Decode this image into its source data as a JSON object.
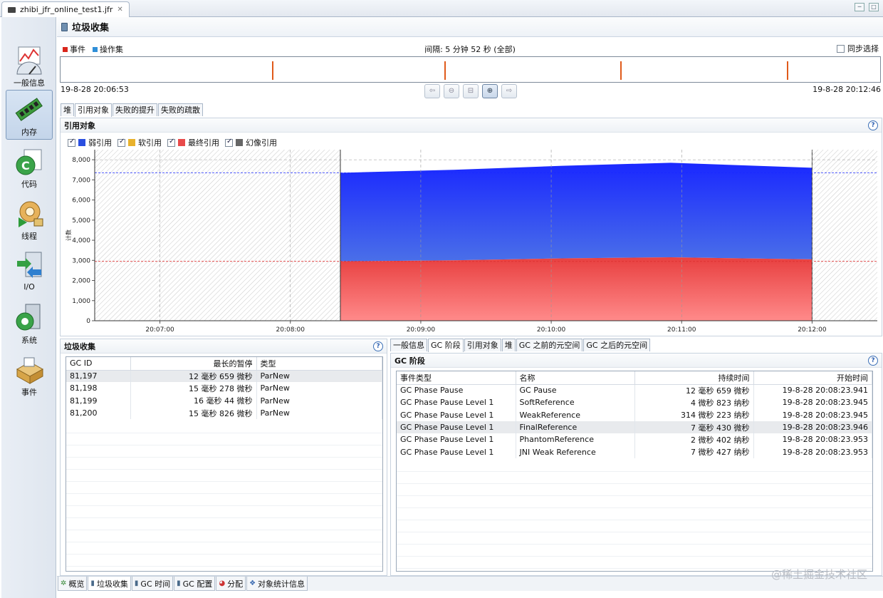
{
  "editor": {
    "file_tab": "zhibi_jfr_online_test1.jfr",
    "close": "✕"
  },
  "window_buttons": [
    "─",
    "□"
  ],
  "nav": [
    {
      "label": "一般信息",
      "icon": "general-info-icon"
    },
    {
      "label": "内存",
      "icon": "memory-icon",
      "active": true
    },
    {
      "label": "代码",
      "icon": "code-icon"
    },
    {
      "label": "线程",
      "icon": "threads-icon"
    },
    {
      "label": "I/O",
      "icon": "io-icon"
    },
    {
      "label": "系统",
      "icon": "system-icon"
    },
    {
      "label": "事件",
      "icon": "events-icon"
    }
  ],
  "header": {
    "title": "垃圾收集"
  },
  "overview": {
    "legend": [
      {
        "label": "事件",
        "color": "#d9261c"
      },
      {
        "label": "操作集",
        "color": "#2f8fd8"
      }
    ],
    "interval": "间隔: 5 分钟 52 秒 (全部)",
    "sync_label": "同步选择",
    "range_start": "19-8-28 20:06:53",
    "range_end": "19-8-28 20:12:46",
    "event_marks": [
      0.258,
      0.468,
      0.683,
      0.886
    ]
  },
  "zoom_buttons": [
    "⇦",
    "⊖",
    "⊟",
    "⊕",
    "⇨"
  ],
  "upper_tabs": [
    "堆",
    "引用对象",
    "失败的提升",
    "失败的疏散"
  ],
  "chart_section": {
    "title": "引用对象",
    "help": "?",
    "legend": [
      {
        "label": "弱引用",
        "color": "#2b4fe0"
      },
      {
        "label": "软引用",
        "color": "#e8b12c"
      },
      {
        "label": "最终引用",
        "color": "#e84a4a"
      },
      {
        "label": "幻像引用",
        "color": "#666666"
      }
    ]
  },
  "chart_data": {
    "type": "area",
    "ylabel": "计数",
    "ylim": [
      0,
      8500
    ],
    "yticks": [
      0,
      1000,
      2000,
      3000,
      4000,
      5000,
      6000,
      7000,
      8000
    ],
    "ytick_labels": [
      "0",
      "1,000",
      "2,000",
      "3,000",
      "4,000",
      "5,000",
      "6,000",
      "7,000",
      "8,000"
    ],
    "xticks": [
      "20:07:00",
      "20:08:00",
      "20:09:00",
      "20:10:00",
      "20:11:00",
      "20:12:00"
    ],
    "x_range_seconds": [
      0,
      360
    ],
    "series": [
      {
        "name": "最终引用",
        "x": [
          "20:08:23",
          "20:09:15",
          "20:10:05",
          "20:10:55",
          "20:12:00"
        ],
        "values": [
          2950,
          3000,
          3100,
          3150,
          3050
        ]
      },
      {
        "name": "弱引用",
        "x": [
          "20:08:23",
          "20:09:15",
          "20:10:05",
          "20:10:55",
          "20:12:00"
        ],
        "values": [
          4400,
          4500,
          4600,
          4700,
          4550
        ]
      }
    ],
    "reference_lines": [
      7350,
      2950
    ],
    "grid": true
  },
  "gc_section": {
    "title": "垃圾收集",
    "help": "?",
    "columns": [
      "GC ID",
      "最长的暂停",
      "类型"
    ],
    "rows": [
      [
        "81,197",
        "12 毫秒 659 微秒",
        "ParNew"
      ],
      [
        "81,198",
        "15 毫秒 278 微秒",
        "ParNew"
      ],
      [
        "81,199",
        "16 毫秒 44 微秒",
        "ParNew"
      ],
      [
        "81,200",
        "15 毫秒 826 微秒",
        "ParNew"
      ]
    ]
  },
  "lower_tabs": [
    "一般信息",
    "GC 阶段",
    "引用对象",
    "堆",
    "GC 之前的元空间",
    "GC 之后的元空间"
  ],
  "phase_section": {
    "title": "GC 阶段",
    "help": "?",
    "columns": [
      "事件类型",
      "名称",
      "持续时间",
      "开始时间"
    ],
    "rows": [
      [
        "GC Phase Pause",
        "GC Pause",
        "12 毫秒 659 微秒",
        "19-8-28 20:08:23.941"
      ],
      [
        "GC Phase Pause Level 1",
        "SoftReference",
        "4 微秒 823 纳秒",
        "19-8-28 20:08:23.945"
      ],
      [
        "GC Phase Pause Level 1",
        "WeakReference",
        "314 微秒 223 纳秒",
        "19-8-28 20:08:23.945"
      ],
      [
        "GC Phase Pause Level 1",
        "FinalReference",
        "7 毫秒 430 微秒",
        "19-8-28 20:08:23.946"
      ],
      [
        "GC Phase Pause Level 1",
        "PhantomReference",
        "2 微秒 402 纳秒",
        "19-8-28 20:08:23.953"
      ],
      [
        "GC Phase Pause Level 1",
        "JNI Weak Reference",
        "7 微秒 427 纳秒",
        "19-8-28 20:08:23.953"
      ]
    ]
  },
  "bottom_tabs": [
    {
      "label": "概览",
      "icon": "overview-icon"
    },
    {
      "label": "垃圾收集",
      "icon": "trash-icon",
      "active": true
    },
    {
      "label": "GC 时间",
      "icon": "gc-time-icon"
    },
    {
      "label": "GC 配置",
      "icon": "gc-config-icon"
    },
    {
      "label": "分配",
      "icon": "allocation-icon"
    },
    {
      "label": "对象统计信息",
      "icon": "object-stats-icon"
    }
  ],
  "watermark": "@稀土掘金技术社区"
}
